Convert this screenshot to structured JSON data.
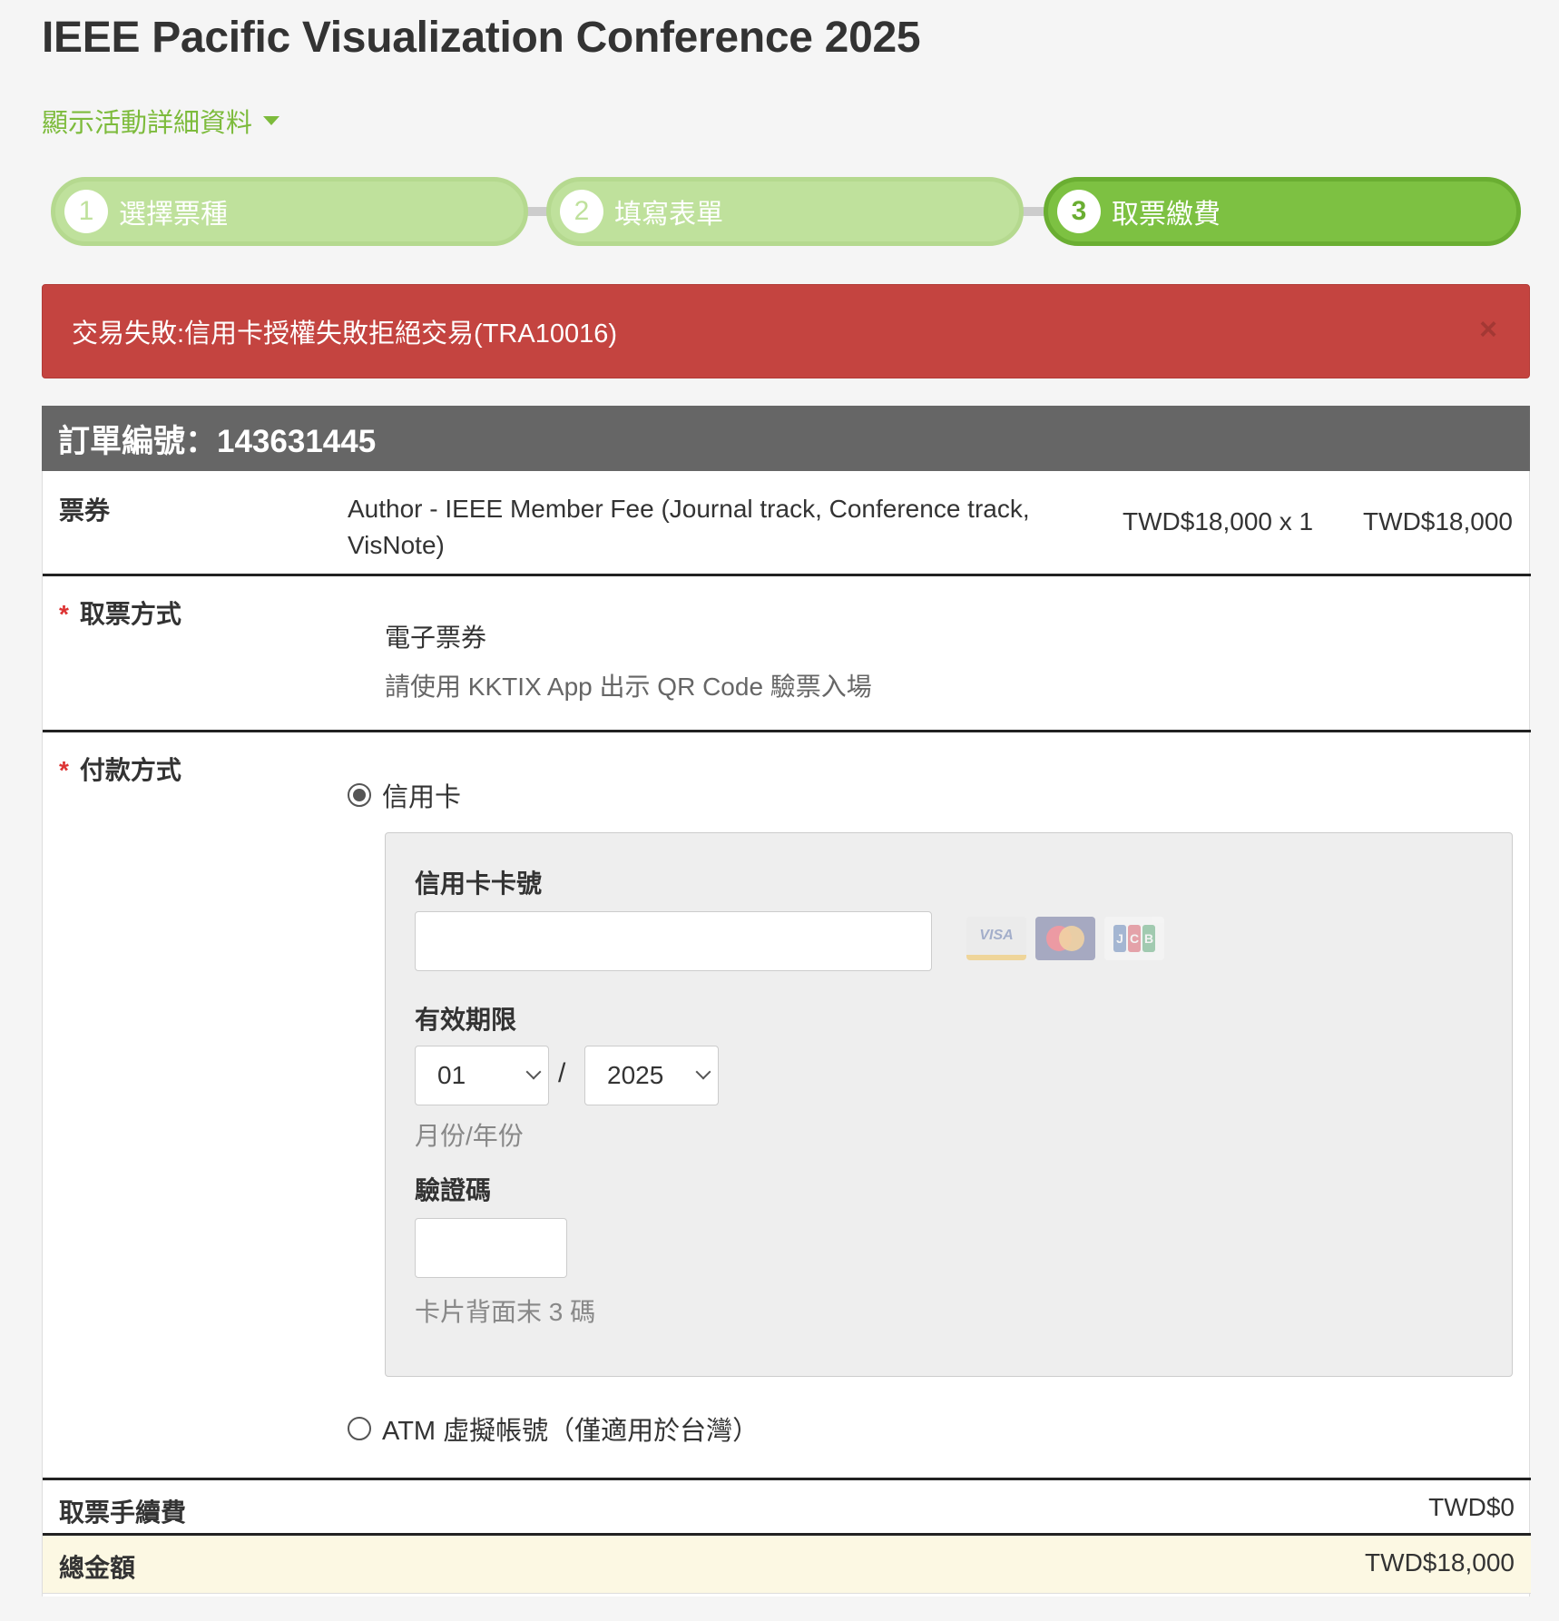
{
  "event": {
    "title": "IEEE Pacific Visualization Conference 2025",
    "details_toggle": "顯示活動詳細資料"
  },
  "steps": [
    {
      "num": "1",
      "label": "選擇票種",
      "active": false
    },
    {
      "num": "2",
      "label": "填寫表單",
      "active": false
    },
    {
      "num": "3",
      "label": "取票繳費",
      "active": true
    }
  ],
  "alert": {
    "message": "交易失敗:信用卡授權失敗拒絕交易(TRA10016)",
    "close": "×",
    "color": "#c44440"
  },
  "order": {
    "header": "訂單編號：143631445",
    "ticket": {
      "label": "票券",
      "name": "Author - IEEE Member Fee (Journal track, Conference track, VisNote)",
      "unit_price": "TWD$18,000 x 1",
      "total": "TWD$18,000"
    },
    "delivery": {
      "label": "取票方式",
      "method": "電子票券",
      "note": "請使用 KKTIX App 出示 QR Code 驗票入場"
    },
    "payment": {
      "label": "付款方式",
      "options": [
        {
          "label": "信用卡",
          "checked": true
        },
        {
          "label": "ATM 虛擬帳號（僅適用於台灣）",
          "checked": false
        }
      ],
      "credit_card": {
        "number_label": "信用卡卡號",
        "number_value": "",
        "expiry_label": "有效期限",
        "month": "01",
        "year": "2025",
        "slash": "/",
        "expiry_help": "月份/年份",
        "cvc_label": "驗證碼",
        "cvc_value": "",
        "cvc_help": "卡片背面末 3 碼",
        "logos": [
          "VISA",
          "mastercard",
          "JCB"
        ]
      }
    },
    "fee": {
      "label": "取票手續費",
      "amount": "TWD$0"
    },
    "total": {
      "label": "總金額",
      "amount": "TWD$18,000"
    }
  },
  "colors": {
    "brand_green": "#7dc142",
    "step_inactive": "#bfe19c",
    "header_gray": "#666666",
    "total_bg": "#fcf8e3"
  }
}
